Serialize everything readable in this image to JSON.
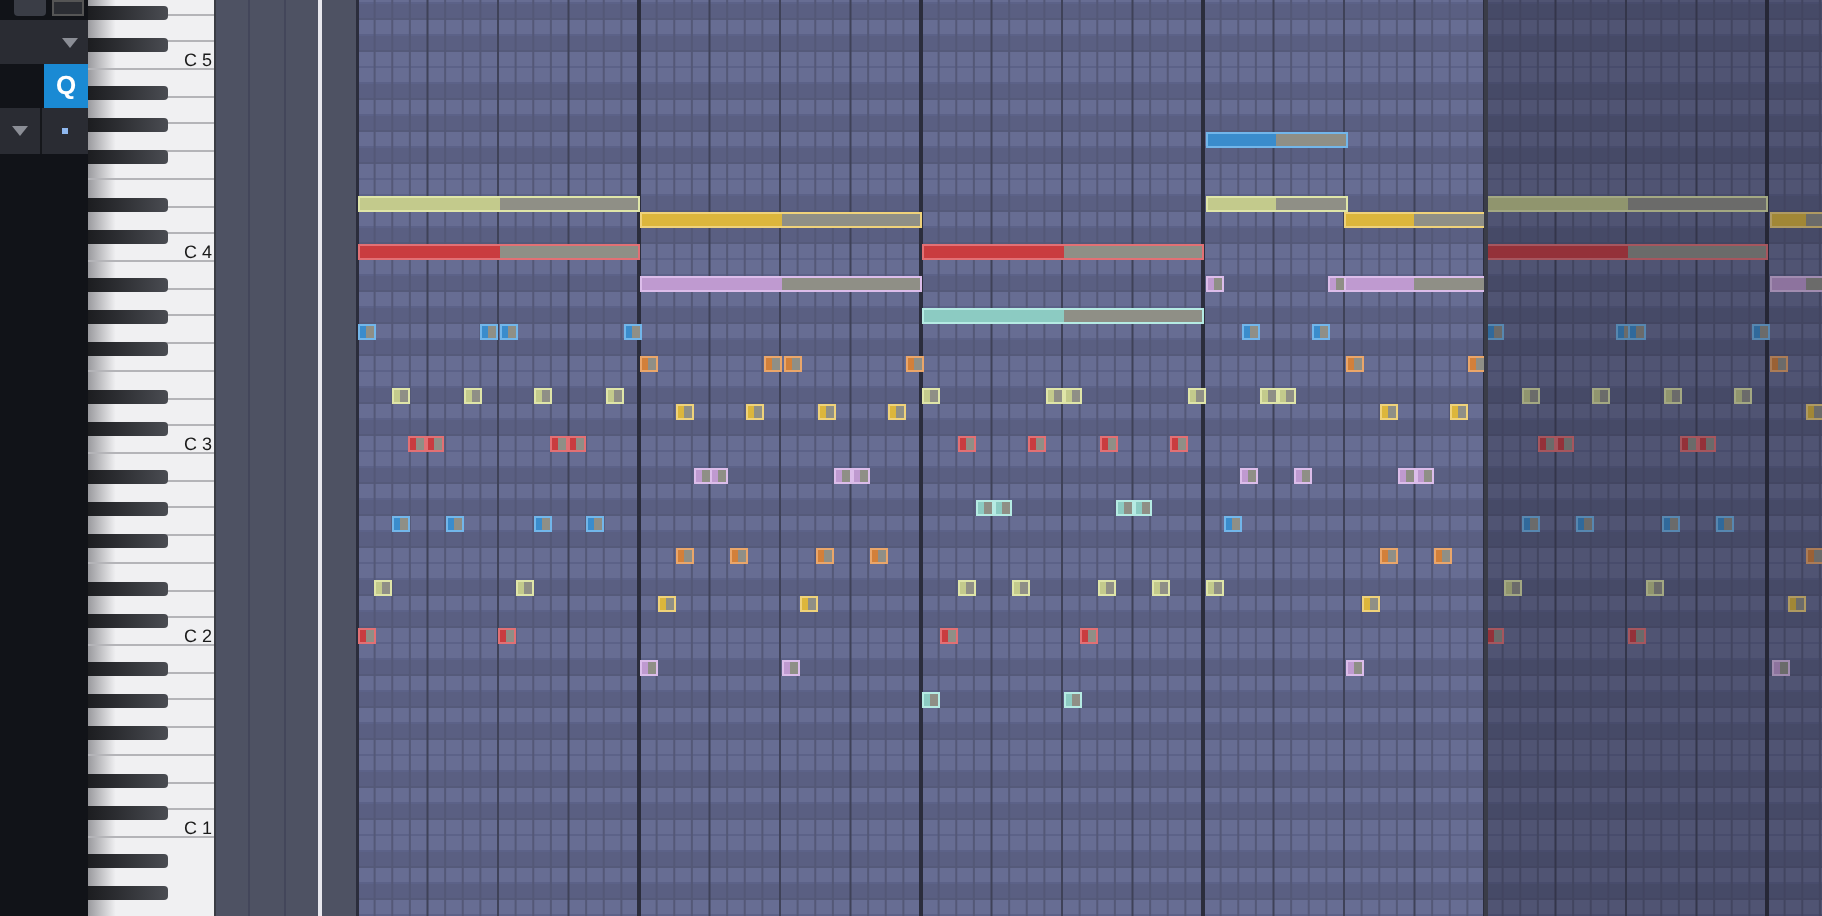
{
  "toolbar": {
    "quantize_button": {
      "label": "Q",
      "selected": true
    }
  },
  "keyboard": {
    "octave_labels": [
      "C 5",
      "C 4",
      "C 3",
      "C 2",
      "C 1"
    ]
  }
}
